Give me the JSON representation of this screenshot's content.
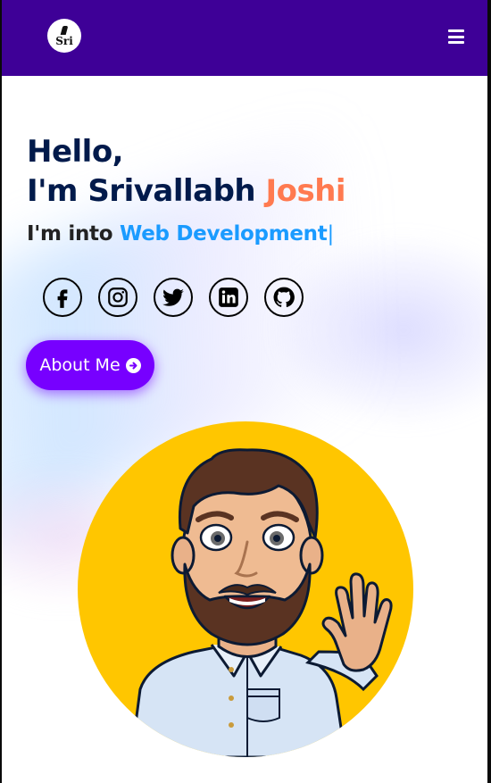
{
  "navbar": {
    "logo_text": "Sri",
    "menu_icon": "hamburger-menu-icon",
    "background_color": "#3e0097"
  },
  "hero": {
    "greeting": "Hello,",
    "name_prefix": "I'm Srivallabh",
    "surname": "Joshi",
    "typed_prefix": "I'm into",
    "typed_text": "Web Development",
    "typed_cursor": "|",
    "heading_color": "#011a4b",
    "accent_color": "#ff7a50",
    "typed_color": "#1a9bff"
  },
  "socials": [
    {
      "name": "facebook-icon"
    },
    {
      "name": "instagram-icon"
    },
    {
      "name": "twitter-icon"
    },
    {
      "name": "linkedin-icon"
    },
    {
      "name": "github-icon"
    }
  ],
  "about_button": {
    "label": "About Me",
    "icon": "arrow-circle-right-icon",
    "color": "#7700ff"
  },
  "avatar": {
    "background_color": "#ffc600"
  }
}
